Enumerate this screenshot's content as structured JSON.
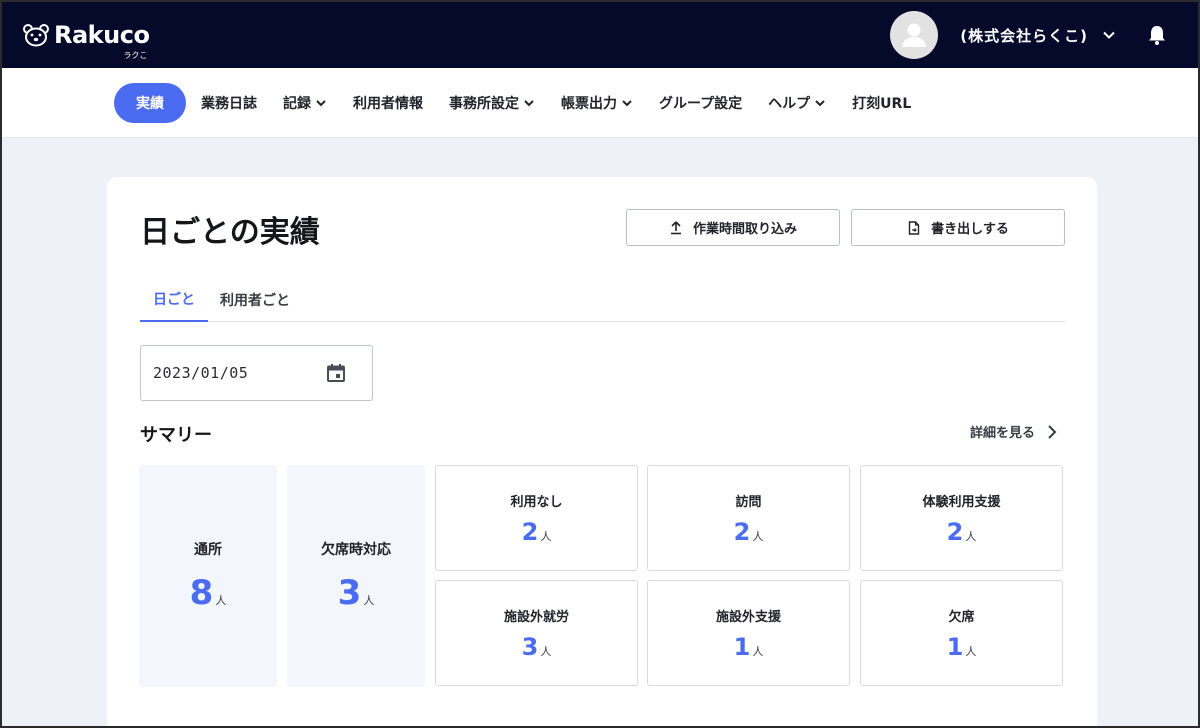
{
  "header": {
    "logo_text": "Rakuco",
    "logo_sub": "ラクこ",
    "company": "(株式会社らくこ)"
  },
  "nav": {
    "items": [
      {
        "label": "実績",
        "active": true,
        "dropdown": false
      },
      {
        "label": "業務日誌",
        "dropdown": false
      },
      {
        "label": "記録",
        "dropdown": true
      },
      {
        "label": "利用者情報",
        "dropdown": false
      },
      {
        "label": "事務所設定",
        "dropdown": true
      },
      {
        "label": "帳票出力",
        "dropdown": true
      },
      {
        "label": "グループ設定",
        "dropdown": false
      },
      {
        "label": "ヘルプ",
        "dropdown": true
      },
      {
        "label": "打刻URL",
        "dropdown": false
      }
    ]
  },
  "page": {
    "title": "日ごとの実績",
    "import_button": "作業時間取り込み",
    "export_button": "書き出しする",
    "tabs": [
      "日ごと",
      "利用者ごと"
    ],
    "date_value": "2023/01/05"
  },
  "summary": {
    "title": "サマリー",
    "detail_link": "詳細を見る",
    "unit": "人",
    "big_tiles": [
      {
        "label": "通所",
        "value": "8"
      },
      {
        "label": "欠席時対応",
        "value": "3"
      }
    ],
    "small_tiles": [
      {
        "label": "利用なし",
        "value": "2"
      },
      {
        "label": "訪問",
        "value": "2"
      },
      {
        "label": "体験利用支援",
        "value": "2"
      },
      {
        "label": "施設外就労",
        "value": "3"
      },
      {
        "label": "施設外支援",
        "value": "1"
      },
      {
        "label": "欠席",
        "value": "1"
      }
    ]
  },
  "colors": {
    "topbar": "#050a2b",
    "accent": "#4b6cf0",
    "tile_bg": "#f3f6fd"
  }
}
